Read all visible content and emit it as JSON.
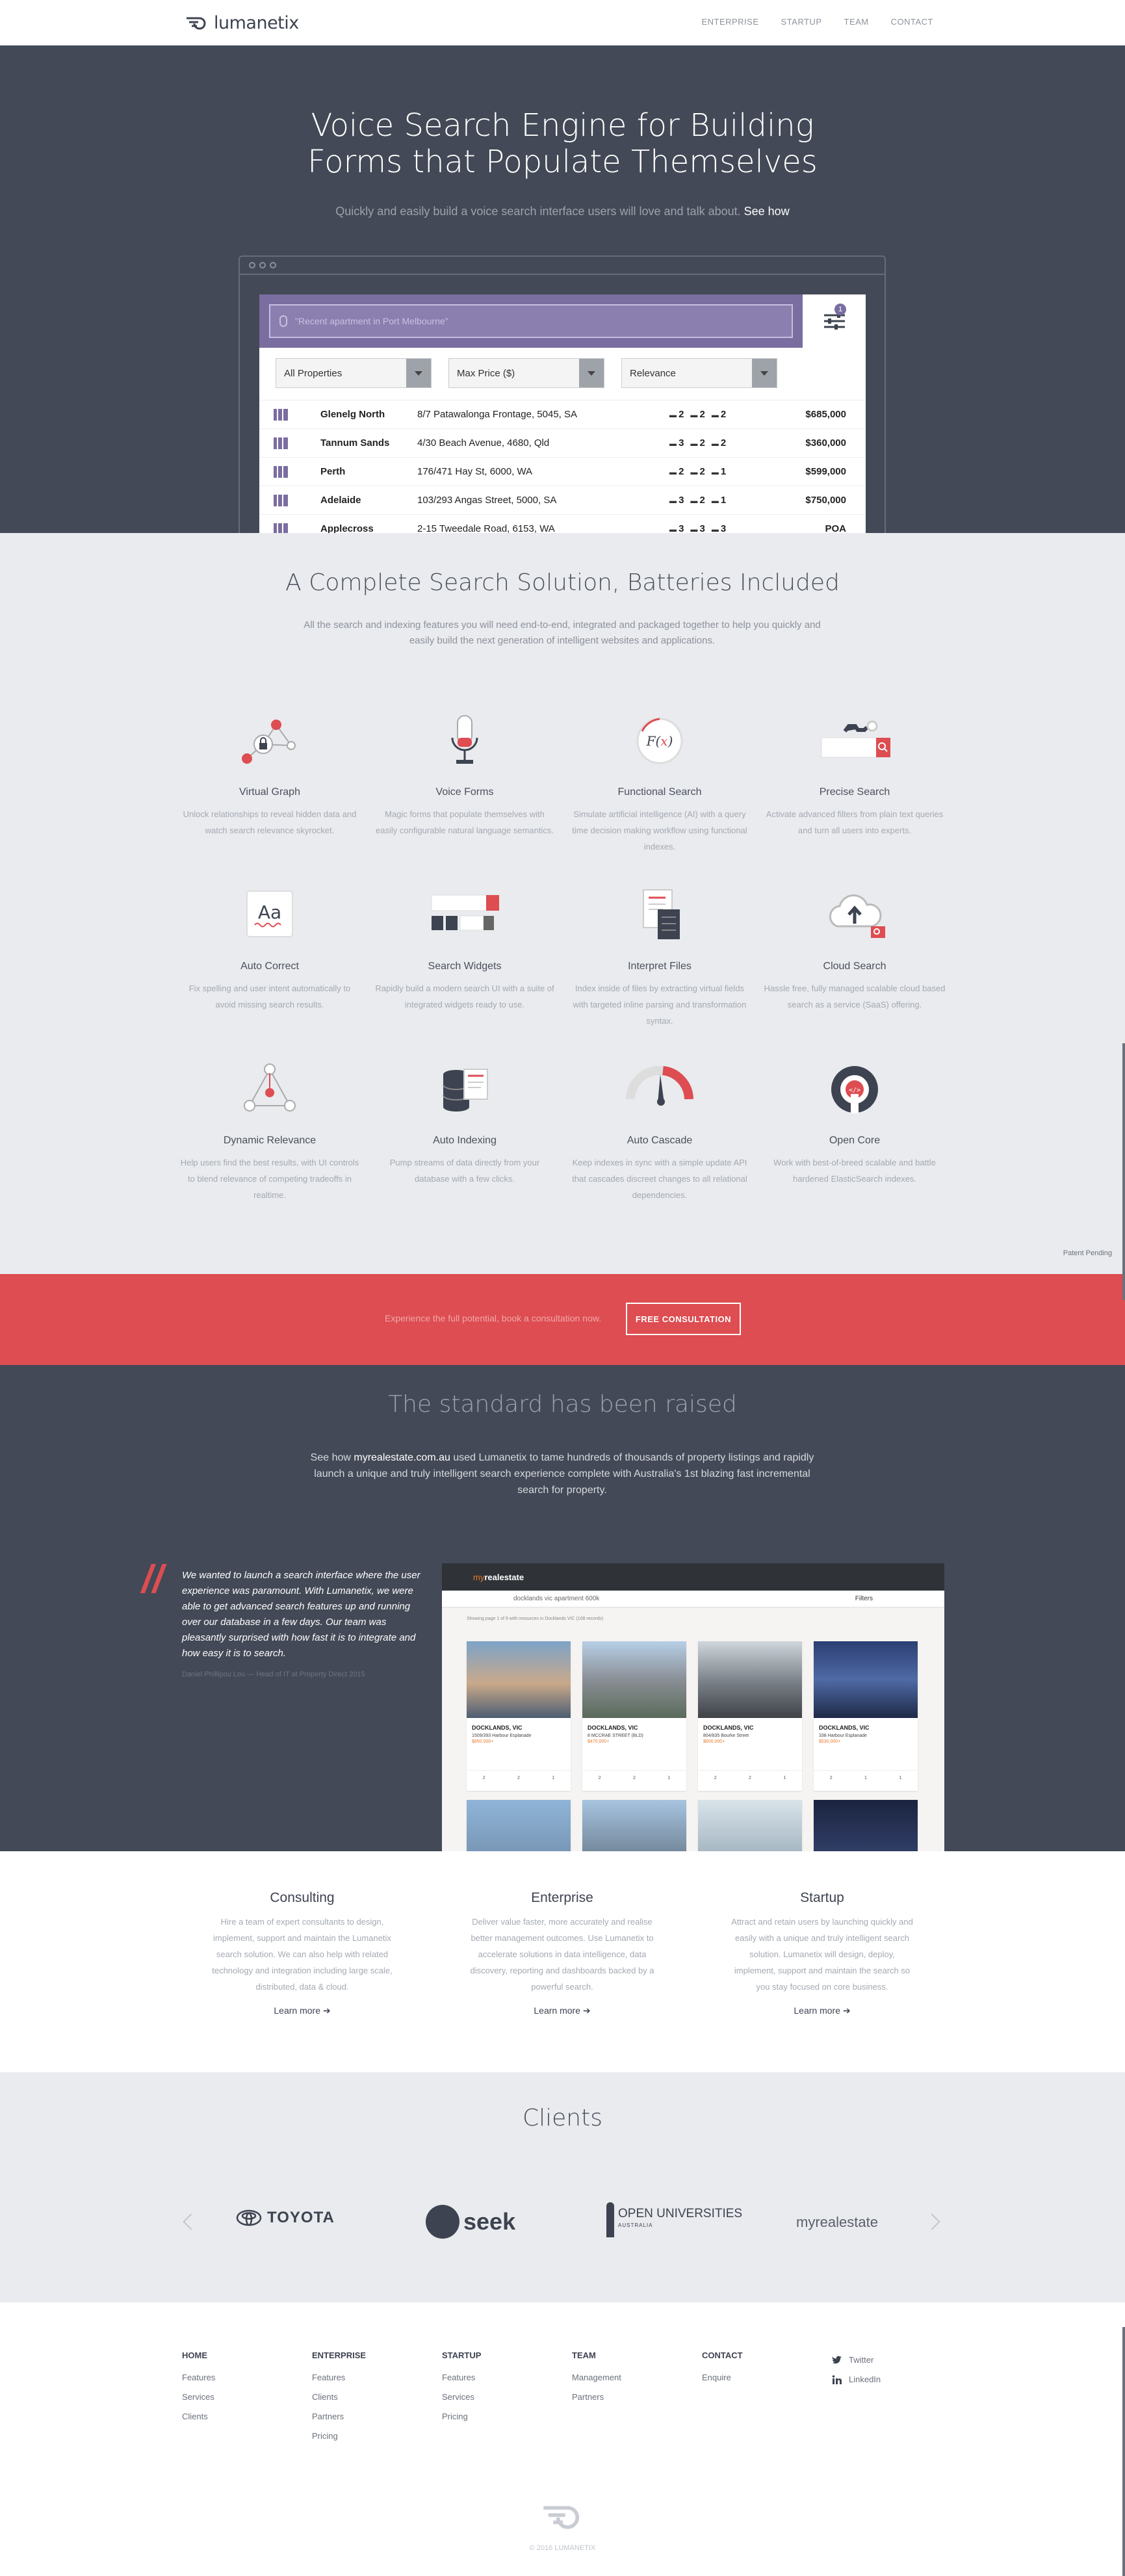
{
  "nav": {
    "brand": "lumanetix",
    "links": [
      "ENTERPRISE",
      "STARTUP",
      "TEAM",
      "CONTACT"
    ]
  },
  "hero": {
    "title_line1": "Voice Search Engine for Building",
    "title_line2": "Forms that Populate Themselves",
    "subtitle": "Quickly and easily build a voice search interface users will love and talk about.",
    "see_how": "See how",
    "search_placeholder": "\"Recent apartment in Port Melbourne\"",
    "filter_count": "1",
    "selects": [
      "All Properties",
      "Max Price ($)",
      "Relevance"
    ],
    "listings": [
      {
        "suburb": "Glenelg North",
        "address": "8/7 Patawalonga Frontage, 5045, SA",
        "beds": "2",
        "baths": "2",
        "cars": "2",
        "price": "$685,000"
      },
      {
        "suburb": "Tannum Sands",
        "address": "4/30 Beach Avenue, 4680, Qld",
        "beds": "3",
        "baths": "2",
        "cars": "2",
        "price": "$360,000"
      },
      {
        "suburb": "Perth",
        "address": "176/471 Hay St, 6000, WA",
        "beds": "2",
        "baths": "2",
        "cars": "1",
        "price": "$599,000"
      },
      {
        "suburb": "Adelaide",
        "address": "103/293 Angas Street, 5000, SA",
        "beds": "3",
        "baths": "2",
        "cars": "1",
        "price": "$750,000"
      },
      {
        "suburb": "Applecross",
        "address": "2-15 Tweedale Road, 6153, WA",
        "beds": "3",
        "baths": "3",
        "cars": "3",
        "price": "POA"
      }
    ]
  },
  "features": {
    "title": "A Complete Search Solution, Batteries Included",
    "desc": "All the search and indexing features you will need end-to-end, integrated and packaged together to help you quickly and easily build the next generation of intelligent websites and applications.",
    "items": [
      {
        "title": "Virtual Graph",
        "desc": "Unlock relationships to reveal hidden data and watch search relevance skyrocket.",
        "icon": "graph-icon"
      },
      {
        "title": "Voice Forms",
        "desc": "Magic forms that populate themselves with easily configurable natural language semantics.",
        "icon": "microphone-icon"
      },
      {
        "title": "Functional Search",
        "desc": "Simulate artificial intelligence (AI) with a query time decision making workflow using functional indexes.",
        "icon": "function-icon"
      },
      {
        "title": "Precise Search",
        "desc": "Activate advanced filters from plain text queries and turn all users into experts.",
        "icon": "search-filter-icon"
      },
      {
        "title": "Auto Correct",
        "desc": "Fix spelling and user intent automatically to avoid missing search results.",
        "icon": "spellcheck-icon"
      },
      {
        "title": "Search Widgets",
        "desc": "Rapidly build a modern search UI with a suite of integrated widgets ready to use.",
        "icon": "widgets-icon"
      },
      {
        "title": "Interpret Files",
        "desc": "Index inside of files by extracting virtual fields with targeted inline parsing and transformation syntax.",
        "icon": "files-icon"
      },
      {
        "title": "Cloud Search",
        "desc": "Hassle free, fully managed scalable cloud based search as a service (SaaS) offering.",
        "icon": "cloud-upload-icon"
      },
      {
        "title": "Dynamic Relevance",
        "desc": "Help users find the best results, with UI controls to blend relevance of competing tradeoffs in realtime.",
        "icon": "triangle-relevance-icon"
      },
      {
        "title": "Auto Indexing",
        "desc": "Pump streams of data directly from your database with a few clicks.",
        "icon": "database-icon"
      },
      {
        "title": "Auto Cascade",
        "desc": "Keep indexes in sync with a simple update API that cascades discreet changes to all relational dependencies.",
        "icon": "gauge-icon"
      },
      {
        "title": "Open Core",
        "desc": "Work with best-of-breed scalable and battle hardened ElasticSearch indexes.",
        "icon": "open-core-icon"
      }
    ],
    "patent": "Patent Pending"
  },
  "cta": {
    "text": "Experience the full potential, book a consultation now.",
    "button": "FREE CONSULTATION"
  },
  "standard": {
    "title": "The standard has been raised",
    "desc_pre": "See how",
    "desc_link": "myrealestate.com.au",
    "desc_post": "used Lumanetix to tame hundreds of thousands of property listings and rapidly launch a unique and truly intelligent search experience complete with Australia's 1st blazing fast incremental search for property.",
    "quote": "We wanted to launch a search interface where the user experience was paramount. With Lumanetix, we were able to get advanced search features up and running over our database in a few days. Our team was pleasantly surprised with how fast it is to integrate and how easy it is to search.",
    "quote_author": "Daniel Phillipou Lou — Head of IT at Property Direct 2015",
    "shot_brand_a": "my",
    "shot_brand_b": "realestate",
    "shot_query": "docklands vic apartment 600k",
    "shot_filters": "Filters",
    "shot_meta": "Showing page 1 of 9 with resources in Docklands VIC (108 records)",
    "cards": [
      {
        "title": "DOCKLANDS, VIC",
        "addr": "1509/393 Harbour Esplanade",
        "price": "$650,000+",
        "bed": "2",
        "bath": "2",
        "car": "1"
      },
      {
        "title": "DOCKLANDS, VIC",
        "addr": "8 MCCRAE STREET (BLD)",
        "price": "$470,000+",
        "bed": "2",
        "bath": "2",
        "car": "1"
      },
      {
        "title": "DOCKLANDS, VIC",
        "addr": "804/835 Bourke Street",
        "price": "$600,000+",
        "bed": "2",
        "bath": "2",
        "car": "1"
      },
      {
        "title": "DOCKLANDS, VIC",
        "addr": "338 Harbour Esplanade",
        "price": "$530,000+",
        "bed": "2",
        "bath": "1",
        "car": "1"
      }
    ]
  },
  "services": [
    {
      "title": "Consulting",
      "desc": "Hire a team of expert consultants to design, implement, support and maintain the Lumanetix search solution. We can also help with related technology and integration including large scale, distributed, data & cloud.",
      "link": "Learn more"
    },
    {
      "title": "Enterprise",
      "desc": "Deliver value faster, more accurately and realise better management outcomes. Use Lumanetix to accelerate solutions in data intelligence, data discovery, reporting and dashboards backed by a powerful search.",
      "link": "Learn more"
    },
    {
      "title": "Startup",
      "desc": "Attract and retain users by launching quickly and easily with a unique and truly intelligent search solution. Lumanetix will design, deploy, implement, support and maintain the search so you stay focused on core business.",
      "link": "Learn more"
    }
  ],
  "clients": {
    "title": "Clients",
    "logos": [
      "TOYOTA",
      "seek",
      "OPEN UNIVERSITIES",
      "AUSTRALIA",
      "myrealestate"
    ]
  },
  "footer": {
    "columns": [
      {
        "head": "HOME",
        "links": [
          "Features",
          "Services",
          "Clients"
        ]
      },
      {
        "head": "ENTERPRISE",
        "links": [
          "Features",
          "Clients",
          "Partners",
          "Pricing"
        ]
      },
      {
        "head": "STARTUP",
        "links": [
          "Features",
          "Services",
          "Pricing"
        ]
      },
      {
        "head": "TEAM",
        "links": [
          "Management",
          "Partners"
        ]
      },
      {
        "head": "CONTACT",
        "links": [
          "Enquire"
        ]
      }
    ],
    "social": [
      "Twitter",
      "LinkedIn"
    ],
    "copyright": "© 2016 LUMANETIX"
  }
}
